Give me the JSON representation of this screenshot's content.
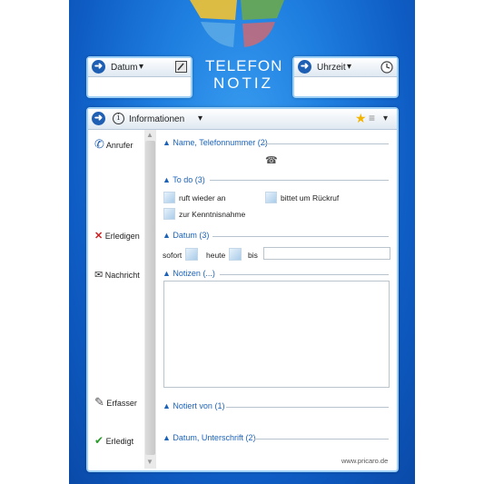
{
  "logo": {
    "line1": "TELEFON",
    "line2": "NOTIZ",
    "colors": [
      "#f1c232",
      "#6aa84f",
      "#e06666",
      "#5aa9e6"
    ]
  },
  "date_box": {
    "label": "Datum",
    "dropdown": "▾",
    "icon": "calendar-icon"
  },
  "time_box": {
    "label": "Uhrzeit",
    "dropdown": "▾",
    "icon": "clock-icon"
  },
  "info_panel": {
    "title": "Informationen",
    "dropdown": "▾",
    "star": "★",
    "menu": "≡"
  },
  "sidebar": {
    "items": [
      {
        "label": "Anrufer",
        "icon": "phone-handset-icon",
        "glyph": "✆"
      },
      {
        "label": "Erledigen",
        "icon": "cross-icon",
        "glyph": "✕"
      },
      {
        "label": "Nachricht",
        "icon": "envelope-icon",
        "glyph": "✉"
      },
      {
        "label": "Erfasser",
        "icon": "pencil-icon",
        "glyph": "✎"
      },
      {
        "label": "Erledigt",
        "icon": "checkmark-icon",
        "glyph": "✔"
      }
    ]
  },
  "sections": {
    "name": {
      "title": "Name, Telefonnummer (2)",
      "phone_glyph": "☎"
    },
    "todo": {
      "title": "To do (3)",
      "opt1": "ruft wieder an",
      "opt2": "bittet um Rückruf",
      "opt3": "zur Kenntnisnahme"
    },
    "datum": {
      "title": "Datum (3)",
      "sofort": "sofort",
      "heute": "heute",
      "bis": "bis"
    },
    "notizen": {
      "title": "Notizen (...)"
    },
    "notiert": {
      "title": "Notiert von (1)"
    },
    "unterschrift": {
      "title": "Datum, Unterschrift (2)"
    }
  },
  "footer": {
    "website": "www.pricaro.de"
  }
}
